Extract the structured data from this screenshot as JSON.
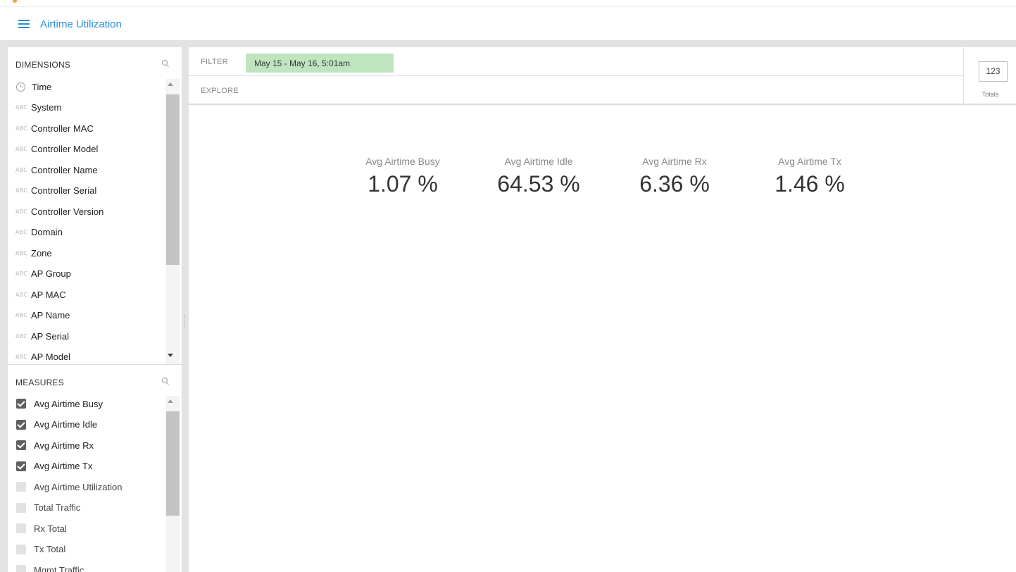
{
  "header": {
    "title": "Airtime Utilization",
    "menu_icon": "hamburger-menu-icon",
    "accent_color": "#2a8fd6"
  },
  "dimensions": {
    "heading": "DIMENSIONS",
    "search_icon": "search-icon",
    "type_badge": "ABC",
    "items": [
      {
        "label": "Time",
        "type": "time"
      },
      {
        "label": "System",
        "type": "string"
      },
      {
        "label": "Controller MAC",
        "type": "string"
      },
      {
        "label": "Controller Model",
        "type": "string"
      },
      {
        "label": "Controller Name",
        "type": "string"
      },
      {
        "label": "Controller Serial",
        "type": "string"
      },
      {
        "label": "Controller Version",
        "type": "string"
      },
      {
        "label": "Domain",
        "type": "string"
      },
      {
        "label": "Zone",
        "type": "string"
      },
      {
        "label": "AP Group",
        "type": "string"
      },
      {
        "label": "AP MAC",
        "type": "string"
      },
      {
        "label": "AP Name",
        "type": "string"
      },
      {
        "label": "AP Serial",
        "type": "string"
      },
      {
        "label": "AP Model",
        "type": "string"
      }
    ]
  },
  "measures": {
    "heading": "MEASURES",
    "search_icon": "search-icon",
    "items": [
      {
        "label": "Avg Airtime Busy",
        "checked": true
      },
      {
        "label": "Avg Airtime Idle",
        "checked": true
      },
      {
        "label": "Avg Airtime Rx",
        "checked": true
      },
      {
        "label": "Avg Airtime Tx",
        "checked": true
      },
      {
        "label": "Avg Airtime Utilization",
        "checked": false
      },
      {
        "label": "Total Traffic",
        "checked": false
      },
      {
        "label": "Rx Total",
        "checked": false
      },
      {
        "label": "Tx Total",
        "checked": false
      },
      {
        "label": "Mgmt Traffic",
        "checked": false
      }
    ]
  },
  "filter": {
    "label": "FILTER",
    "chip": "May 15 - May 16, 5:01am",
    "chip_color": "#bfe5bf"
  },
  "explore": {
    "label": "EXPLORE"
  },
  "totals": {
    "icon_text": "123",
    "label": "Totals"
  },
  "metrics": [
    {
      "label": "Avg Airtime Busy",
      "value": "1.07 %"
    },
    {
      "label": "Avg Airtime Idle",
      "value": "64.53 %"
    },
    {
      "label": "Avg Airtime Rx",
      "value": "6.36 %"
    },
    {
      "label": "Avg Airtime Tx",
      "value": "1.46 %"
    }
  ]
}
